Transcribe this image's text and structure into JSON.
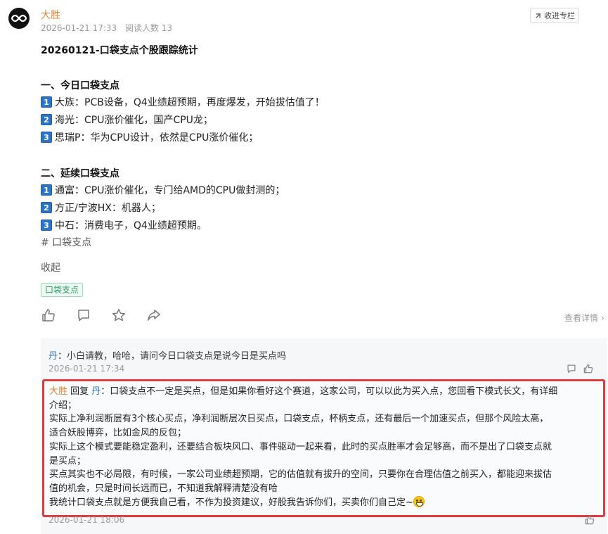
{
  "header": {
    "author": "大胜",
    "date": "2026-01-21 17:33",
    "read_count": "阅读人数 13",
    "collect_label": "收进专栏"
  },
  "article": {
    "title": "20260121-口袋支点个股跟踪统计",
    "section1": {
      "heading": "一、今日口袋支点",
      "items": [
        {
          "num": "1",
          "text": "大族：PCB设备，Q4业绩超预期，再度爆发，开始拔估值了！"
        },
        {
          "num": "2",
          "text": "海光：CPU涨价催化，国产CPU龙；"
        },
        {
          "num": "3",
          "text": "思瑞P：华为CPU设计，依然是CPU涨价催化；"
        }
      ]
    },
    "section2": {
      "heading": "二、延续口袋支点",
      "items": [
        {
          "num": "1",
          "text": "通富：CPU涨价催化，专门给AMD的CPU做封测的；"
        },
        {
          "num": "2",
          "text": "方正/宁波HX：机器人；"
        },
        {
          "num": "3",
          "text": "中石：消费电子，Q4业绩超预期。"
        }
      ]
    },
    "hashtag": "# 口袋支点",
    "collapse": "收起",
    "tag": "口袋支点"
  },
  "actions": {
    "detail": "查看详情 ›"
  },
  "comments": [
    {
      "author": "丹",
      "text": "：小白请教，哈哈，请问今日口袋支点是说今日是买点吗",
      "time": "2026-01-21 17:34"
    }
  ],
  "reply": {
    "author": "大胜",
    "reply_word": " 回复 ",
    "target": "丹",
    "lines": [
      "：口袋支点不一定是买点，但是如果你看好这个赛道，这家公司，可以以此为买入点，您回看下模式长文，有详细",
      "介绍；",
      "实际上净利润断层有3个核心买点，净利润断层次日买点，口袋支点，杯柄支点，还有最后一个加速买点，但那个风险太高，",
      "适合妖股博弈，比如金风的反包；",
      "实际上这个模式要能稳定盈利，还要结合板块风口、事件驱动一起来看，此时的买点胜率才会足够高，而不是出了口袋支点就",
      "是买点；",
      "买点其实也不必局限，有时候，一家公司业绩超预期，它的估值就有拔升的空间，只要你在合理估值之前买入，都能迎来拔估",
      "值的机会，只是时间长远而已，不知道我解释清楚没有哈",
      "我统计口袋支点就是方便我自己看，不作为投资建议，好股我告诉你们，买卖你们自己定~"
    ],
    "emoji_icon": "grin-emoji-icon",
    "time": "2026-01-21 18:06"
  },
  "colors": {
    "author": "#e2853b",
    "commenter": "#2d74c9",
    "highlight_border": "#e03a3a",
    "tag_green": "#2a9d6a",
    "number_badge": "#2d74c9"
  }
}
